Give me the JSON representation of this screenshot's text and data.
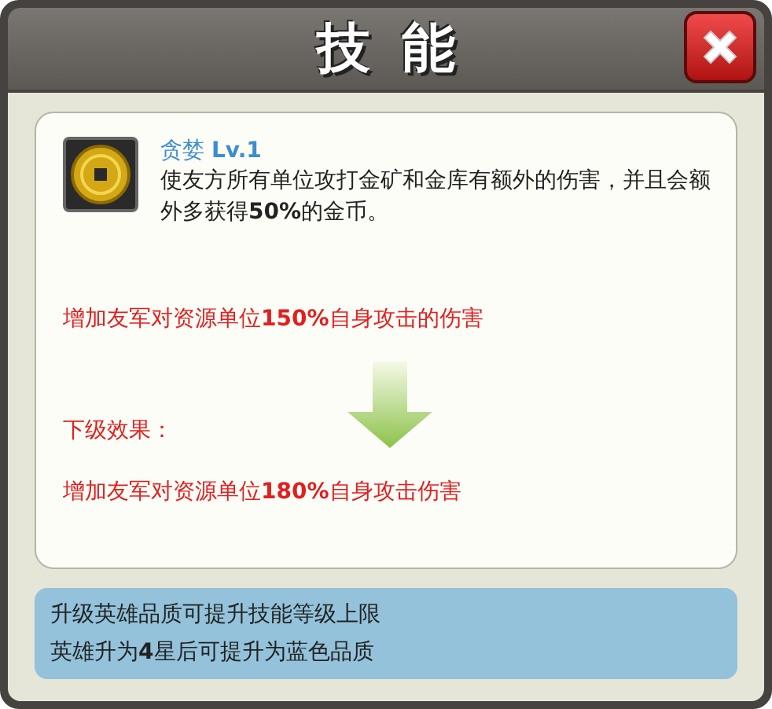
{
  "dialog": {
    "title": "技能"
  },
  "skill": {
    "name": "贪婪 **Lv.1**",
    "description": "使友方所有单位攻打金矿和金库有额外的伤害，并且会额外多获得**50%**的金币。"
  },
  "current_effect": "增加友军对资源单位**150%**自身攻击的伤害",
  "next_label": "下级效果：",
  "next_effect": "增加友军对资源单位**180%**自身攻击伤害",
  "notes": [
    "升级英雄品质可提升技能等级上限",
    "英雄升为**4**星后可提升为蓝色品质"
  ]
}
